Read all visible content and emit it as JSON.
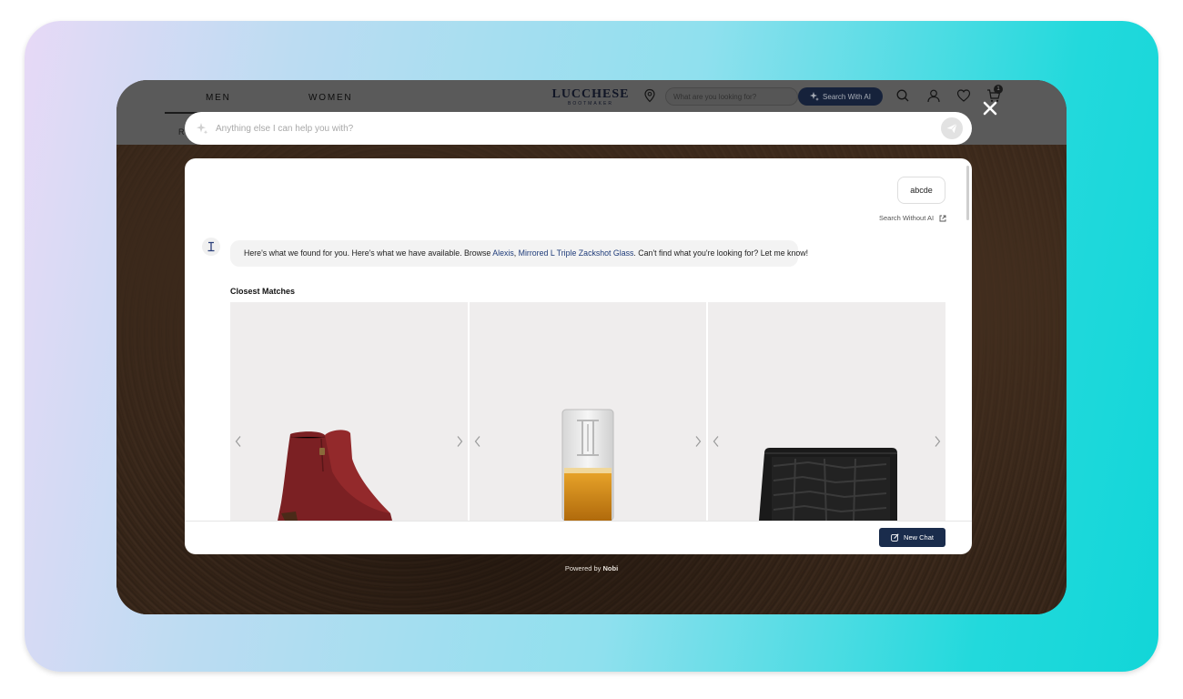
{
  "site_nav": {
    "men": "MEN",
    "women": "WOMEN",
    "sub_first_letter": "R",
    "logo_main": "LUCCHESE",
    "logo_sub": "BOOTMAKER",
    "search_placeholder": "What are you looking for?",
    "ai_button": "Search With AI",
    "cart_count": "1"
  },
  "prompt": {
    "placeholder": "Anything else I can help you with?"
  },
  "chat": {
    "user_message": "abcde",
    "search_without_ai": "Search Without AI",
    "bot_text_before": "Here's what we found for you. Here's what we have available. Browse ",
    "bot_link_1": "Alexis",
    "bot_sep": ", ",
    "bot_link_2": "Mirrored L Triple Zackshot Glass",
    "bot_text_after": ". Can't find what you're looking for? Let me know!",
    "closest_matches": "Closest Matches",
    "products": [
      {
        "icon": "red-ankle-boot-image"
      },
      {
        "icon": "shot-glass-image"
      },
      {
        "icon": "black-croc-wallet-image"
      }
    ],
    "new_chat": "New Chat"
  },
  "footer": {
    "powered_prefix": "Powered by ",
    "powered_brand": "Nobi"
  },
  "colors": {
    "brand_navy": "#1a2c4c",
    "link": "#1f3c7a"
  }
}
